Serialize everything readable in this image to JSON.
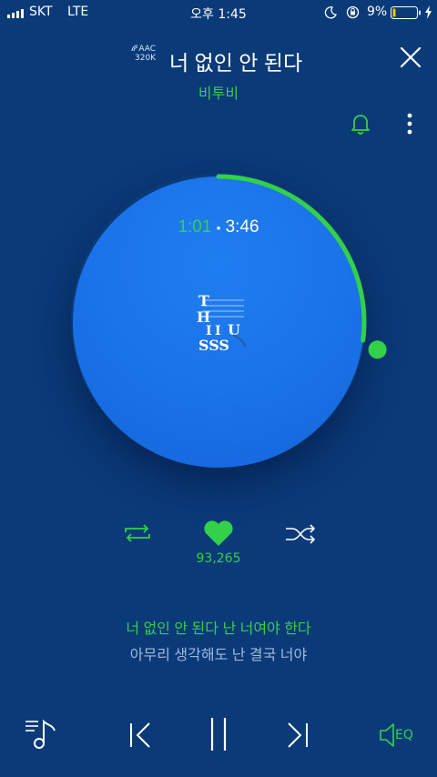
{
  "status_bar": {
    "carrier": "SKT",
    "network": "LTE",
    "time": "오후 1:45",
    "battery_percent": "9%"
  },
  "header": {
    "codec": "AAC",
    "bitrate": "320K",
    "song_title": "너 없인 안 된다",
    "artist": "비투비"
  },
  "player": {
    "elapsed": "1:01",
    "separator": "•",
    "duration": "3:46",
    "progress_fraction": 0.27,
    "likes": "93,265"
  },
  "album_logo": {
    "text": "THIS US"
  },
  "lyrics": {
    "current": "너 없인 안 된다 난 너여야 한다",
    "next": "아무리 생각해도 난 결국 너야"
  },
  "controls": {
    "eq_label": "EQ"
  },
  "colors": {
    "background": "#0a3a78",
    "accent": "#33d14a",
    "disc": "#1a72e8"
  }
}
